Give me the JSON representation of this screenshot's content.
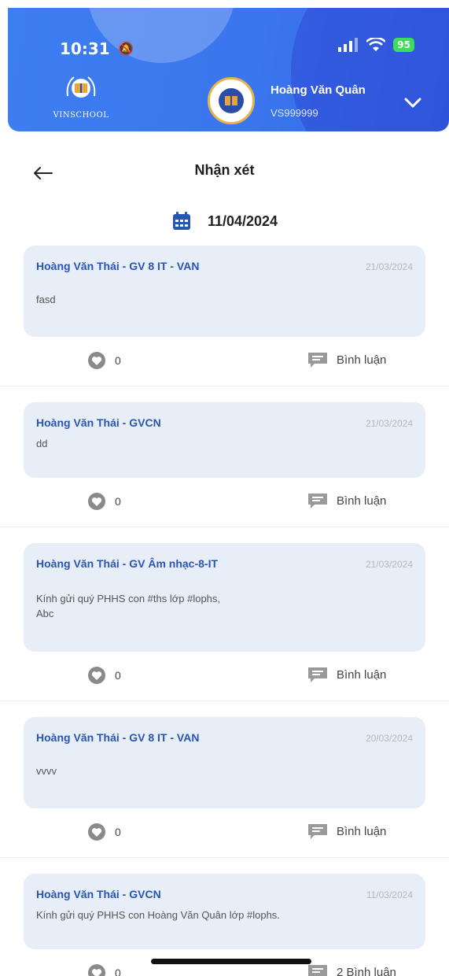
{
  "status_bar": {
    "time": "10:31",
    "battery": "95"
  },
  "header": {
    "school_name": "VINSCHOOL",
    "user_name": "Hoàng Văn Quân",
    "user_id": "VS999999"
  },
  "page": {
    "title": "Nhận xét",
    "date": "11/04/2024"
  },
  "feed": [
    {
      "teacher": "Hoàng Văn Thái - GV 8 IT - VAN",
      "date": "21/03/2024",
      "content": "fasd",
      "likes": "0",
      "comment_label": "Bình luận"
    },
    {
      "teacher": "Hoàng Văn Thái - GVCN",
      "date": "21/03/2024",
      "content": "dd",
      "likes": "0",
      "comment_label": "Bình luận"
    },
    {
      "teacher": "Hoàng Văn Thái - GV Âm nhạc-8-IT",
      "date": "21/03/2024",
      "content": "Kính gửi quý PHHS con #ths lớp #lophs,\nAbc",
      "likes": "0",
      "comment_label": "Bình luận"
    },
    {
      "teacher": "Hoàng Văn Thái - GV 8 IT - VAN",
      "date": "20/03/2024",
      "content": "vvvv",
      "likes": "0",
      "comment_label": "Bình luận"
    },
    {
      "teacher": "Hoàng Văn Thái - GVCN",
      "date": "11/03/2024",
      "content": "Kính gửi quý PHHS con Hoàng Văn Quân lớp #lophs.",
      "likes": "0",
      "comment_label": "2 Bình luận"
    }
  ],
  "colors": {
    "header": "#3a76ee",
    "teacher_name": "#2855b3",
    "card_bg": "#e8eef7",
    "icon_gray": "#8a8a8a"
  }
}
